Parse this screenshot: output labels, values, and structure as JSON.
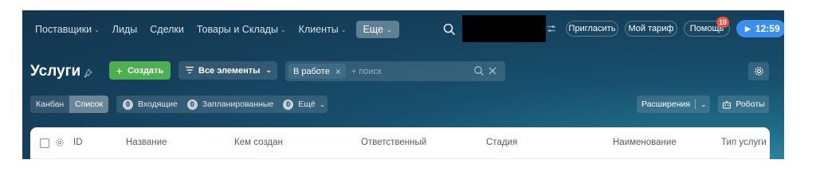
{
  "nav": {
    "items": [
      {
        "label": "Поставщики",
        "dropdown": true
      },
      {
        "label": "Лиды",
        "dropdown": false
      },
      {
        "label": "Сделки",
        "dropdown": false
      },
      {
        "label": "Товары и Склады",
        "dropdown": true
      },
      {
        "label": "Клиенты",
        "dropdown": true
      }
    ],
    "more_label": "Еще",
    "search_icon": "search-icon"
  },
  "header_right": {
    "invite_label": "Пригласить",
    "tariff_label": "Мой тариф",
    "help_label": "Помощь",
    "help_badge": "10",
    "time": "12:59"
  },
  "page": {
    "title": "Услуги",
    "create_label": "Создать",
    "all_elements_label": "Все элементы",
    "filter_chip": "В работе",
    "search_placeholder": "+ поиск"
  },
  "toolbar": {
    "views": [
      {
        "label": "Канбан",
        "active": false
      },
      {
        "label": "Список",
        "active": true
      }
    ],
    "counters": [
      {
        "count": "0",
        "label": "Входящие"
      },
      {
        "count": "0",
        "label": "Запланированные"
      },
      {
        "count": "0",
        "label": "Ещё"
      }
    ],
    "extensions_label": "Расширения",
    "robots_label": "Роботы"
  },
  "table": {
    "columns": [
      "ID",
      "Название",
      "Кем создан",
      "Ответственный",
      "Стадия",
      "Наименование",
      "Тип услуги"
    ]
  },
  "colors": {
    "accent_green": "#4caf50",
    "accent_blue": "#3c8ff0",
    "badge_red": "#f04e3e",
    "header_bg": "#153f5b"
  }
}
